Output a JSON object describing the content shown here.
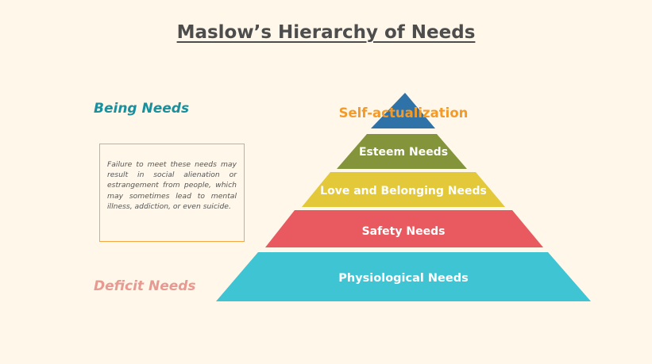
{
  "title": "Maslow’s Hierarchy of Needs",
  "labels": {
    "being": "Being Needs",
    "deficit": "Deficit Needs"
  },
  "note": "Failure to meet these needs may result in social alienation or estrangement from people, which may sometimes lead to mental illness, addiction, or even suicide.",
  "pyramid": {
    "tiers": [
      {
        "name": "Self-actualization",
        "color": "#2f72a8"
      },
      {
        "name": "Esteem Needs",
        "color": "#84943a"
      },
      {
        "name": "Love and Belonging Needs",
        "color": "#e3c83a"
      },
      {
        "name": "Safety Needs",
        "color": "#e85a5f"
      },
      {
        "name": "Physiological Needs",
        "color": "#3fc4d4"
      }
    ],
    "apex_label_color": "#f39b2a"
  },
  "colors": {
    "background": "#fef7ea",
    "title": "#4d4d4d",
    "being": "#1b8f9c",
    "deficit": "#e79a91",
    "note_border": "#f5a743"
  }
}
